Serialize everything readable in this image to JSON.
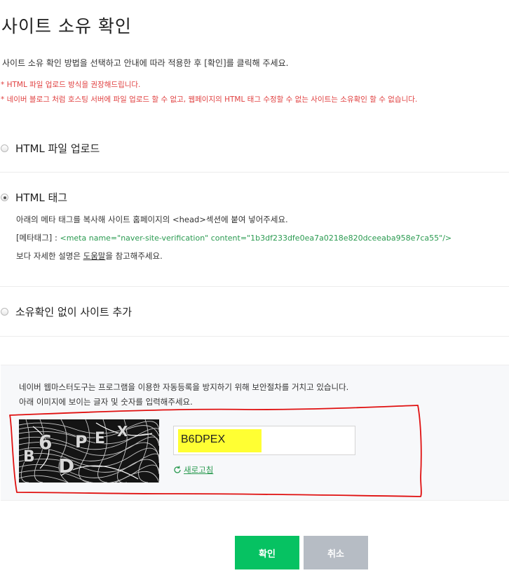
{
  "page": {
    "title": "사이트 소유 확인",
    "description": "사이트 소유 확인 방법을 선택하고 안내에 따라 적용한 후 [확인]를 클릭해 주세요.",
    "notes": [
      "* HTML 파일 업로드 방식을 권장해드립니다.",
      "* 네이버 블로그 처럼 호스팅 서버에 파일 업로드 할 수 없고, 웹페이지의 HTML 태그 수정할 수 없는 사이트는 소유확인 할 수 없습니다."
    ]
  },
  "options": [
    {
      "label": "HTML 파일 업로드",
      "checked": false
    },
    {
      "label": "HTML 태그",
      "checked": true
    },
    {
      "label": "소유확인 없이 사이트 추가",
      "checked": false
    }
  ],
  "html_tag": {
    "instruction": "아래의 메타 태그를 복사해 사이트 홈페이지의 <head>섹션에 붙여 넣어주세요.",
    "meta_label": "[메타태그] : ",
    "meta_code": "<meta name=\"naver-site-verification\" content=\"1b3df233dfe0ea7a0218e820dceeaba958e7ca55\"/>",
    "help_prefix": "보다 자세한 설명은 ",
    "help_link": "도움말",
    "help_suffix": "을 참고해주세요."
  },
  "captcha": {
    "line1": "네이버 웹마스터도구는 프로그램을 이용한 자동등록을 방지하기 위해 보안절차를 거치고 있습니다.",
    "line2": "아래 이미지에 보이는 글자 및 숫자를 입력해주세요.",
    "input_value": "B6DPEX",
    "refresh_label": "새로고침",
    "highlight_color": "#ffff33",
    "annotation_color": "#e01010"
  },
  "buttons": {
    "confirm": "확인",
    "cancel": "취소",
    "confirm_color": "#06c262",
    "cancel_color": "#b6bcc4"
  }
}
